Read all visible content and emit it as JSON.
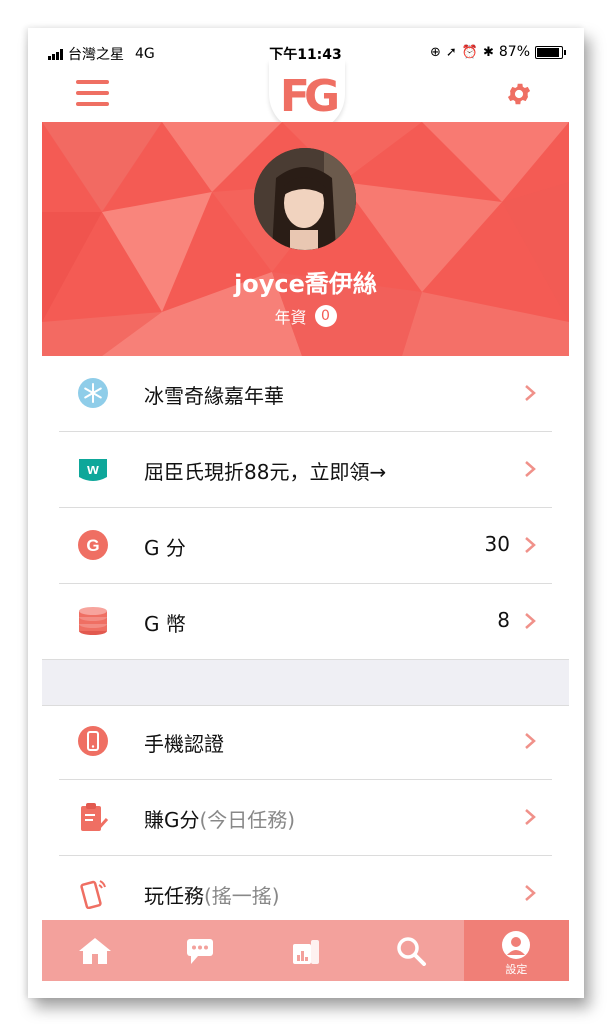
{
  "status_bar": {
    "carrier": "台灣之星",
    "network": "4G",
    "time": "下午11:43",
    "battery": "87%",
    "battery_level": 0.87
  },
  "header": {
    "logo_text": "FG",
    "menu_icon": "hamburger-icon",
    "settings_icon": "gear-icon"
  },
  "profile": {
    "username": "joyce喬伊絲",
    "seniority_label": "年資",
    "seniority_value": "0"
  },
  "menu_section_1": [
    {
      "icon": "snowflake-icon",
      "label": "冰雪奇緣嘉年華",
      "value": ""
    },
    {
      "icon": "watsons-icon",
      "label": "屈臣氏現折88元，立即領→",
      "value": ""
    },
    {
      "icon": "g-points-icon",
      "label": "G 分",
      "value": "30"
    },
    {
      "icon": "g-coins-icon",
      "label": "G 幣",
      "value": "8"
    }
  ],
  "menu_section_2": [
    {
      "icon": "phone-verify-icon",
      "label": "手機認證",
      "sub": ""
    },
    {
      "icon": "clipboard-task-icon",
      "label": "賺G分",
      "sub": "(今日任務)"
    },
    {
      "icon": "shake-phone-icon",
      "label": "玩任務",
      "sub": "(搖一搖)"
    }
  ],
  "tab_bar": [
    {
      "icon": "home-icon",
      "label": ""
    },
    {
      "icon": "chat-icon",
      "label": ""
    },
    {
      "icon": "ranking-icon",
      "label": ""
    },
    {
      "icon": "search-icon",
      "label": ""
    },
    {
      "icon": "profile-icon",
      "label": "設定"
    }
  ],
  "colors": {
    "accent": "#ef6f63",
    "hero_bg": "#f45b54",
    "tab_bar": "#f3a19c",
    "tab_active": "#f07f77"
  }
}
